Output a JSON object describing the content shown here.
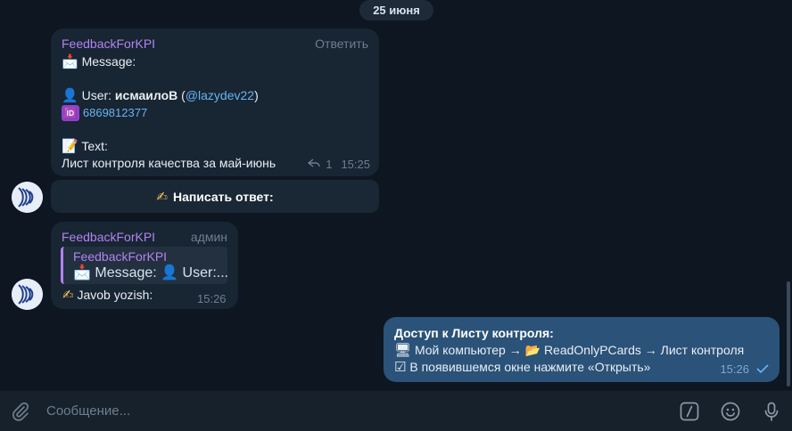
{
  "date_separator": "25 июня",
  "message1": {
    "sender": "FeedbackForKPI",
    "reply_action": "Ответить",
    "envelope_icon": "📩",
    "message_label": "Message:",
    "user_icon": "👤",
    "user_label": "User:",
    "user_name": "исмаилоВ",
    "open_paren": "(",
    "username": "@lazydev22",
    "close_paren": ")",
    "id_icon": "🆔",
    "user_id": "6869812377",
    "memo_icon": "📝",
    "text_label": "Text:",
    "text_body": "Лист контроля качества за май-июнь",
    "replies_count": "1",
    "time": "15:25"
  },
  "inline_button": {
    "icon": "✍",
    "label": "Написать ответ:"
  },
  "message2": {
    "sender": "FeedbackForKPI",
    "role": "админ",
    "quote_sender": "FeedbackForKPI",
    "quote_preview": "📩 Message: 👤 User:...",
    "icon": "✍",
    "text": "Javob yozish:",
    "time": "15:26"
  },
  "message3": {
    "title": "Доступ к Листу контроля:",
    "line1_icon": "🖥",
    "line1": "Мой компьютер → 📂 ReadOnlyPCards → Лист контроля",
    "line2_icon": "☑",
    "line2": "В появившемся окне нажмите «Открыть»",
    "time": "15:26"
  },
  "composer": {
    "placeholder": "Сообщение..."
  },
  "colors": {
    "background": "#0e1621",
    "incoming_bubble": "#182533",
    "outgoing_bubble": "#2b5278",
    "sender": "#b283f0",
    "link": "#6ab3f3"
  }
}
